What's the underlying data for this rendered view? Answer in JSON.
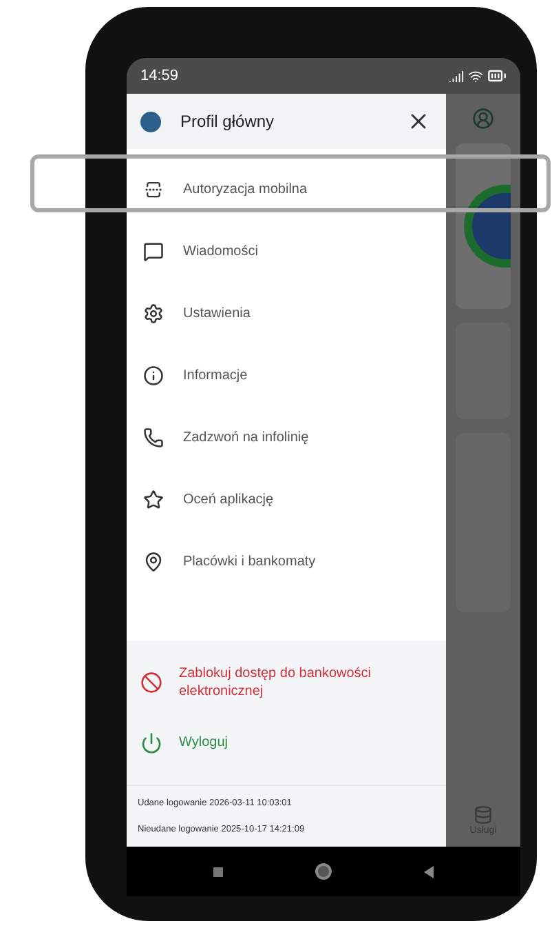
{
  "status_bar": {
    "time": "14:59"
  },
  "drawer": {
    "title": "Profil główny",
    "items": [
      {
        "label": "Autoryzacja mobilna"
      },
      {
        "label": "Wiadomości"
      },
      {
        "label": "Ustawienia"
      },
      {
        "label": "Informacje"
      },
      {
        "label": "Zadzwoń na infolinię"
      },
      {
        "label": "Oceń aplikację"
      },
      {
        "label": "Placówki i bankomaty"
      }
    ],
    "actions": [
      {
        "kind": "block",
        "label": "Zablokuj dostęp do bankowości elektronicznej"
      },
      {
        "kind": "logout",
        "label": "Wyloguj"
      }
    ],
    "login_info": [
      "Udane logowanie 2026-03-11 10:03:01",
      "Nieudane logowanie 2025-10-17 14:21:09"
    ]
  },
  "background_app": {
    "services_label": "Usługi"
  }
}
